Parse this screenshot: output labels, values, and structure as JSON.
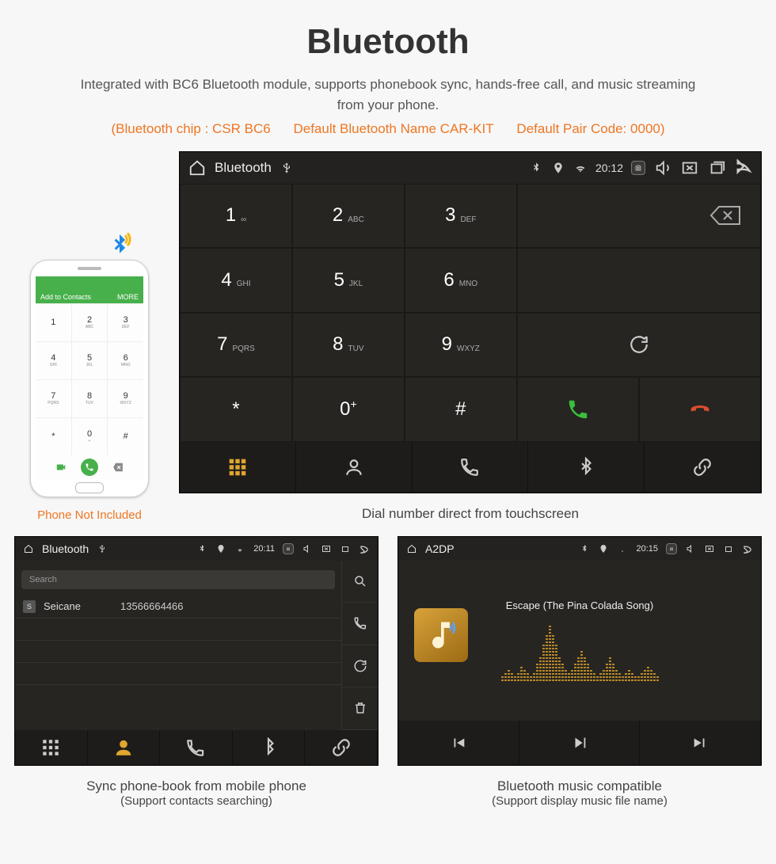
{
  "hero": {
    "title": "Bluetooth",
    "desc": "Integrated with BC6 Bluetooth module, supports phonebook sync, hands-free call, and music streaming from your phone.",
    "spec_chip": "(Bluetooth chip : CSR BC6",
    "spec_name": "Default Bluetooth Name CAR-KIT",
    "spec_pair": "Default Pair Code: 0000)"
  },
  "phone_mock": {
    "header_left": "Add to Contacts",
    "header_right": "MORE",
    "keys": [
      {
        "n": "1",
        "l": ""
      },
      {
        "n": "2",
        "l": "ABC"
      },
      {
        "n": "3",
        "l": "DEF"
      },
      {
        "n": "4",
        "l": "GHI"
      },
      {
        "n": "5",
        "l": "JKL"
      },
      {
        "n": "6",
        "l": "MNO"
      },
      {
        "n": "7",
        "l": "PQRS"
      },
      {
        "n": "8",
        "l": "TUV"
      },
      {
        "n": "9",
        "l": "WXYZ"
      },
      {
        "n": "*",
        "l": ""
      },
      {
        "n": "0",
        "l": "+"
      },
      {
        "n": "#",
        "l": ""
      }
    ],
    "caption": "Phone Not Included"
  },
  "dialer": {
    "status_title": "Bluetooth",
    "status_time": "20:12",
    "keys": [
      {
        "n": "1",
        "l": "∞"
      },
      {
        "n": "2",
        "l": "ABC"
      },
      {
        "n": "3",
        "l": "DEF"
      },
      {
        "n": "4",
        "l": "GHI"
      },
      {
        "n": "5",
        "l": "JKL"
      },
      {
        "n": "6",
        "l": "MNO"
      },
      {
        "n": "7",
        "l": "PQRS"
      },
      {
        "n": "8",
        "l": "TUV"
      },
      {
        "n": "9",
        "l": "WXYZ"
      },
      {
        "n": "*",
        "l": ""
      },
      {
        "n": "0",
        "l": "+"
      },
      {
        "n": "#",
        "l": ""
      }
    ],
    "caption": "Dial number direct from touchscreen"
  },
  "phonebook": {
    "status_title": "Bluetooth",
    "status_time": "20:11",
    "search_placeholder": "Search",
    "contact_initial": "S",
    "contact_name": "Seicane",
    "contact_number": "13566664466",
    "caption_line1": "Sync phone-book from mobile phone",
    "caption_line2": "(Support contacts searching)"
  },
  "a2dp": {
    "status_title": "A2DP",
    "status_time": "20:15",
    "song": "Escape (The Pina Colada Song)",
    "caption_line1": "Bluetooth music compatible",
    "caption_line2": "(Support display music file name)"
  }
}
